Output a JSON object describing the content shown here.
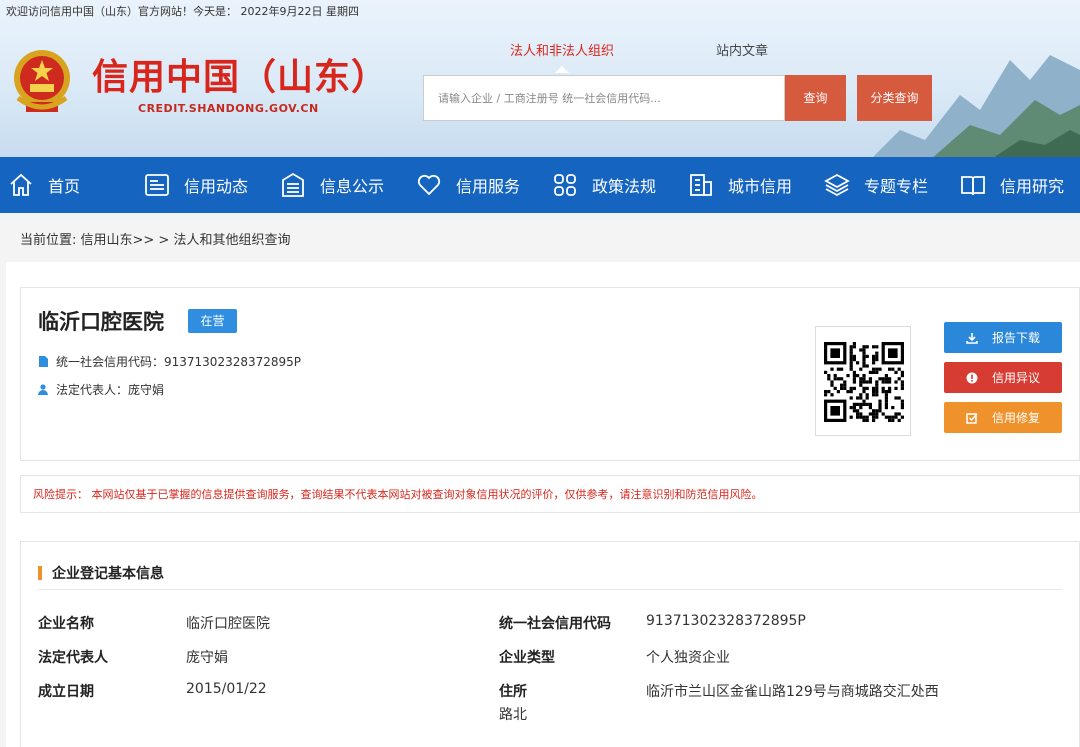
{
  "header": {
    "welcome": "欢迎访问信用中国（山东）官方网站！今天是： 2022年9月22日 星期四",
    "title": "信用中国（山东）",
    "domain": "CREDIT.SHANDONG.GOV.CN",
    "search_tabs": [
      "法人和非法人组织",
      "站内文章"
    ],
    "search_placeholder": "请输入企业 / 工商注册号 统一社会信用代码...",
    "query_label": "查询",
    "category_label": "分类查询"
  },
  "nav": {
    "items": [
      {
        "label": "首页",
        "icon": "home-icon"
      },
      {
        "label": "信用动态",
        "icon": "news-icon"
      },
      {
        "label": "信息公示",
        "icon": "document-icon"
      },
      {
        "label": "信用服务",
        "icon": "heart-icon"
      },
      {
        "label": "政策法规",
        "icon": "grid-icon"
      },
      {
        "label": "城市信用",
        "icon": "building-icon"
      },
      {
        "label": "专题专栏",
        "icon": "layers-icon"
      },
      {
        "label": "信用研究",
        "icon": "book-icon"
      }
    ]
  },
  "breadcrumb": "当前位置:  信用山东>>  >  法人和其他组织查询",
  "company": {
    "name": "临沂口腔医院",
    "status": "在营",
    "credit_code_line": "统一社会信用代码：91371302328372895P",
    "legal_rep_line": "法定代表人：庞守娟",
    "actions": {
      "download": "报告下载",
      "dispute": "信用异议",
      "repair": "信用修复"
    }
  },
  "risk_notice": "风险提示： 本网站仅基于已掌握的信息提供查询服务，查询结果不代表本网站对被查询对象信用状况的评价，仅供参考，请注意识别和防范信用风险。",
  "registration": {
    "section_title": "企业登记基本信息",
    "fields": [
      {
        "label": "企业名称",
        "value": "临沂口腔医院"
      },
      {
        "label": "统一社会信用代码",
        "value": "91371302328372895P"
      },
      {
        "label": "法定代表人",
        "value": "庞守娟"
      },
      {
        "label": "企业类型",
        "value": "个人独资企业"
      },
      {
        "label": "成立日期",
        "value": "2015/01/22"
      },
      {
        "label": "住所",
        "value": "临沂市兰山区金雀山路129号与商城路交汇处西"
      },
      {
        "label": "",
        "value": "路北"
      }
    ]
  },
  "colors": {
    "brand_red": "#d9261c",
    "nav_blue": "#1565c0",
    "badge_blue": "#2f8ee0",
    "accent_orange": "#f0922b"
  }
}
